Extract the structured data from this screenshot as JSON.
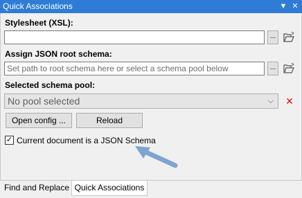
{
  "window": {
    "title": "Quick Associations",
    "menu_glyph": "▼",
    "close_glyph": "✕"
  },
  "stylesheet": {
    "label": "Stylesheet (XSL):",
    "value": "",
    "browse_label": "..."
  },
  "root_schema": {
    "label": "Assign JSON root schema:",
    "placeholder": "Set path to root schema here or select a schema pool below",
    "browse_label": "..."
  },
  "schema_pool": {
    "label": "Selected schema pool:",
    "selected": "No pool selected",
    "clear_glyph": "✕"
  },
  "buttons": {
    "open_config": "Open config ...",
    "reload": "Reload"
  },
  "json_schema_check": {
    "label": "Current document is a JSON Schema",
    "checked": true,
    "mark": "✓"
  },
  "tabs": [
    {
      "label": "Find and Replace",
      "active": false
    },
    {
      "label": "Quick Associations",
      "active": true
    }
  ],
  "colors": {
    "titlebar": "#2e7cd6",
    "arrow": "#7ea4cf",
    "clear_x": "#dd1111"
  },
  "icons": {
    "folder": "open-folder-icon",
    "dropdown": "chevron-down-icon",
    "annotation": "arrow-annotation"
  }
}
